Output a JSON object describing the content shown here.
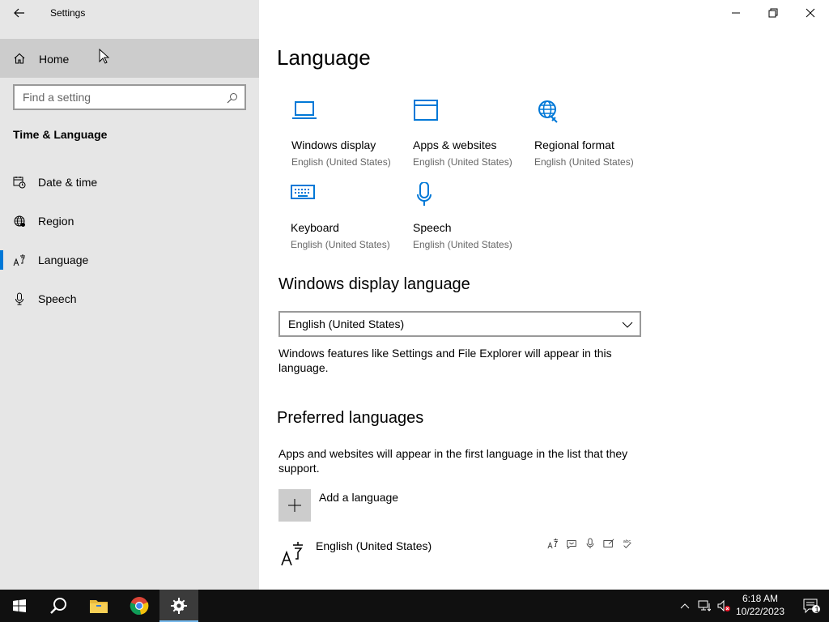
{
  "window": {
    "title": "Settings"
  },
  "sidebar": {
    "home_label": "Home",
    "search_placeholder": "Find a setting",
    "section_title": "Time & Language",
    "items": [
      {
        "label": "Date & time",
        "icon": "calendar-clock-icon",
        "selected": false
      },
      {
        "label": "Region",
        "icon": "globe-icon",
        "selected": false
      },
      {
        "label": "Language",
        "icon": "language-icon",
        "selected": true
      },
      {
        "label": "Speech",
        "icon": "microphone-icon",
        "selected": false
      }
    ]
  },
  "main": {
    "title": "Language",
    "tiles": [
      {
        "title": "Windows display",
        "subtitle": "English (United States)",
        "icon": "monitor-icon"
      },
      {
        "title": "Apps & websites",
        "subtitle": "English (United States)",
        "icon": "browser-window-icon"
      },
      {
        "title": "Regional format",
        "subtitle": "English (United States)",
        "icon": "regional-globe-icon"
      },
      {
        "title": "Keyboard",
        "subtitle": "English (United States)",
        "icon": "keyboard-icon"
      },
      {
        "title": "Speech",
        "subtitle": "English (United States)",
        "icon": "microphone-icon"
      }
    ],
    "display_language": {
      "heading": "Windows display language",
      "selected": "English (United States)",
      "description": "Windows features like Settings and File Explorer will appear in this language."
    },
    "preferred": {
      "heading": "Preferred languages",
      "description": "Apps and websites will appear in the first language in the list that they support.",
      "add_label": "Add a language",
      "languages": [
        {
          "name": "English (United States)"
        }
      ]
    }
  },
  "taskbar": {
    "time": "6:18 AM",
    "date": "10/22/2023",
    "notification_count": "1"
  },
  "colors": {
    "accent": "#0078d7",
    "sidebar_bg": "#e6e6e6",
    "taskbar_bg": "#101010"
  }
}
